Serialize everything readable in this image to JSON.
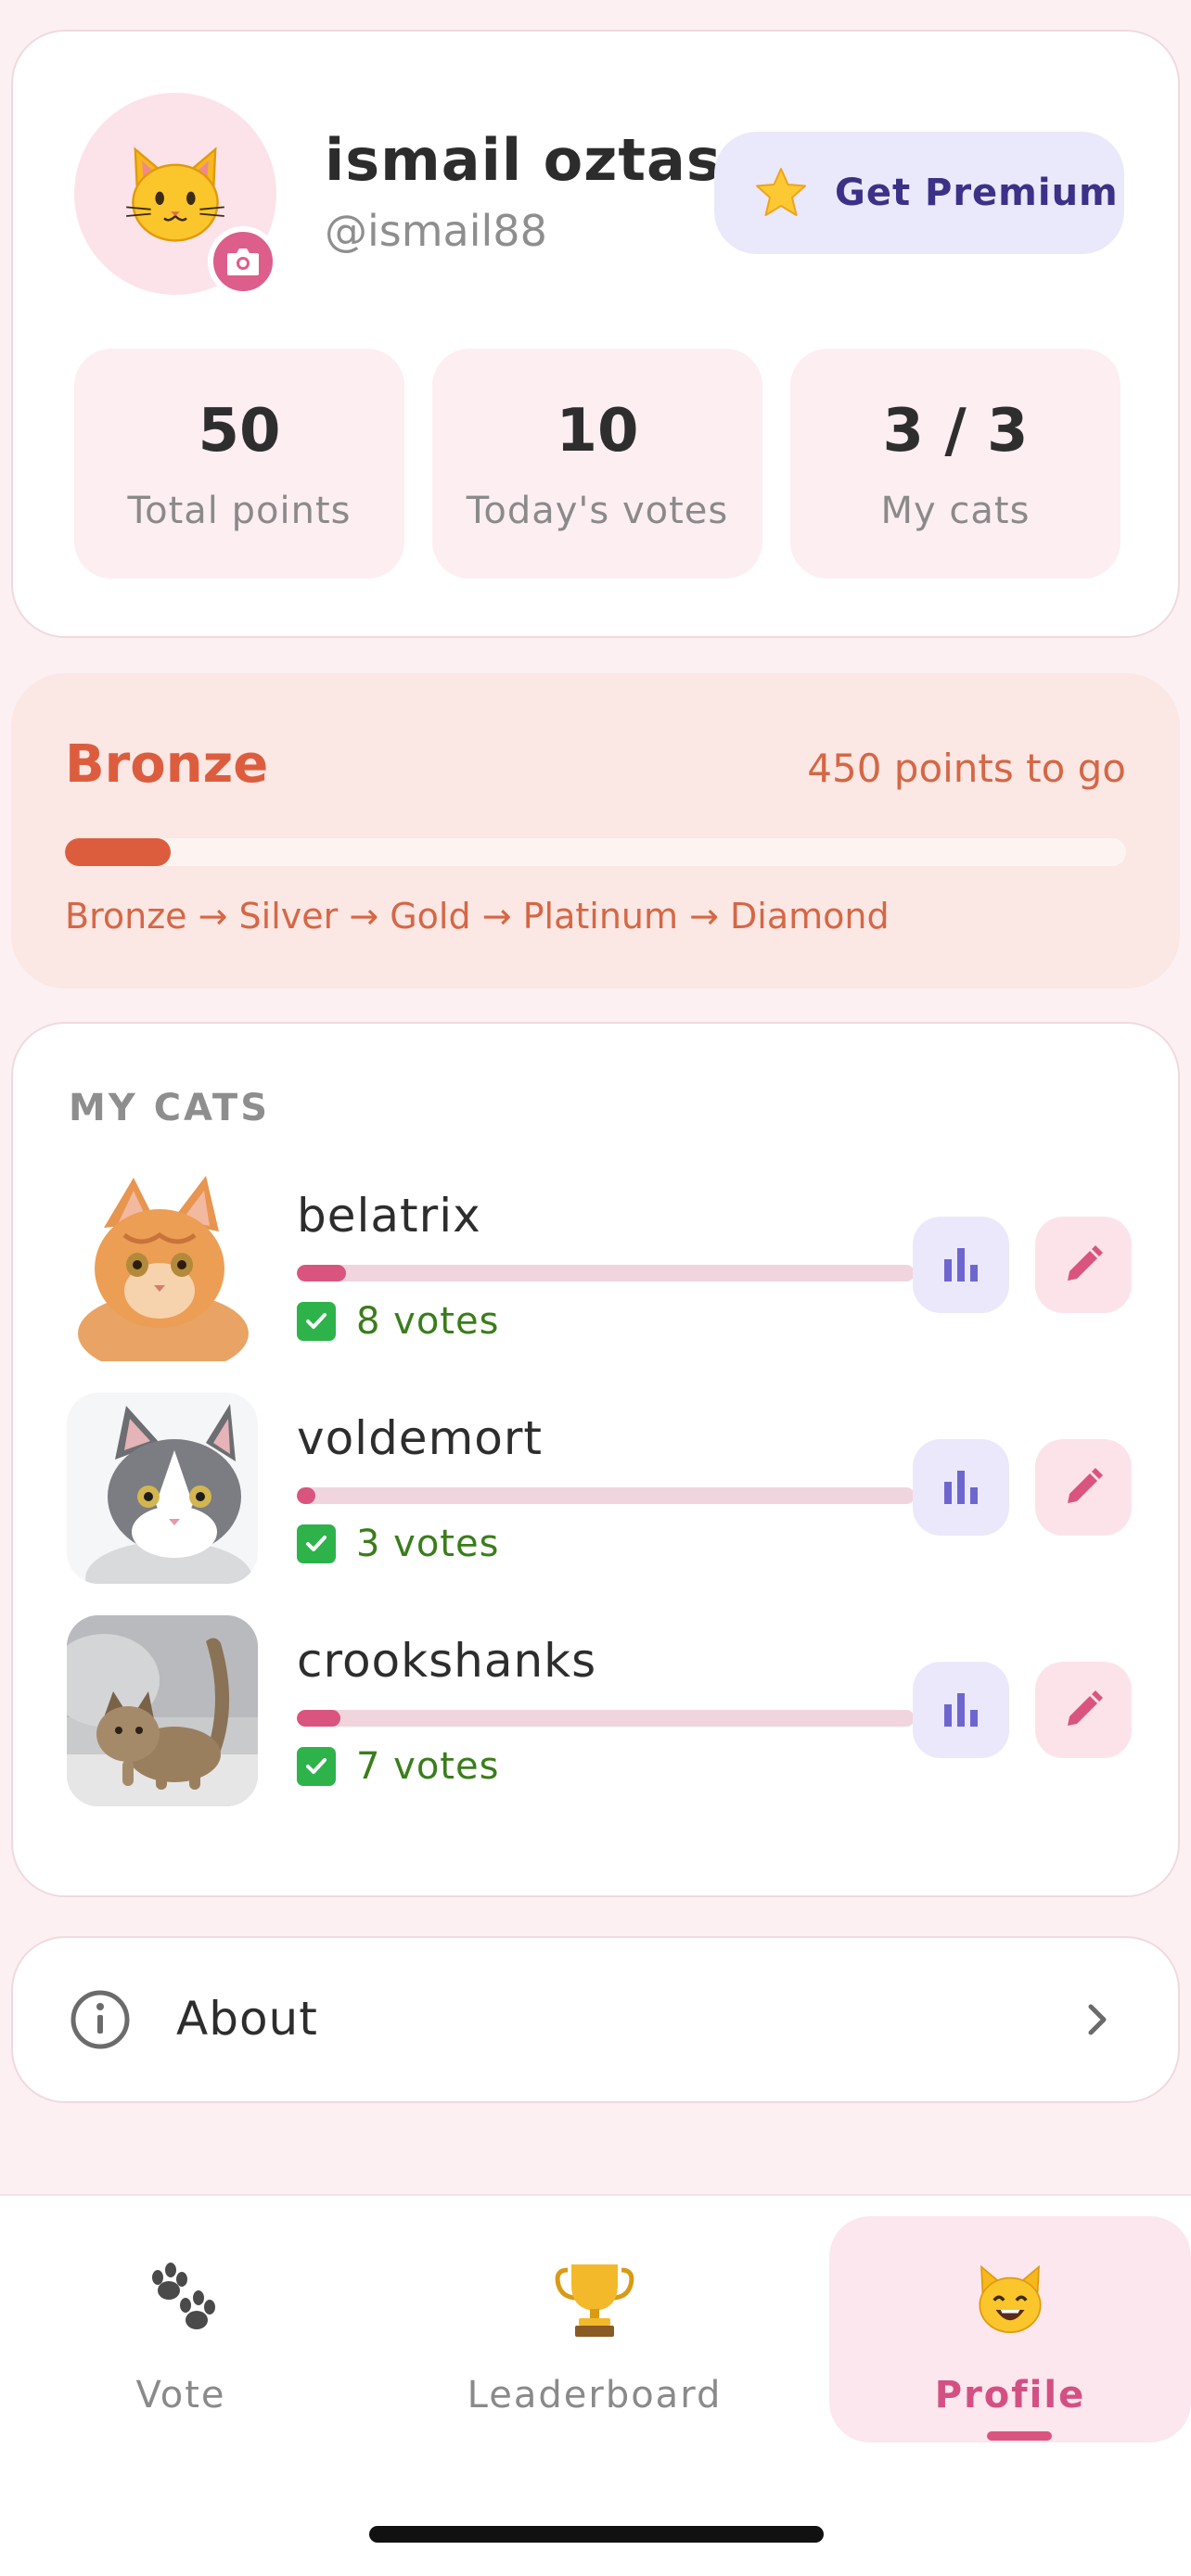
{
  "profile": {
    "name": "ismail oztas",
    "handle": "@ismail88",
    "avatar_icon": "cat-face-icon",
    "premium_button": {
      "label": "Get Premium",
      "icon": "star-icon"
    },
    "stats": [
      {
        "value": "50",
        "label": "Total points"
      },
      {
        "value": "10",
        "label": "Today's votes"
      },
      {
        "value": "3 / 3",
        "label": "My cats"
      }
    ]
  },
  "rank": {
    "name": "Bronze",
    "remaining": "450 points to go",
    "progress_percent": 10,
    "path": "Bronze → Silver → Gold → Platinum → Diamond",
    "color": "#dc5d3e"
  },
  "my_cats": {
    "title": "MY CATS",
    "cats": [
      {
        "name": "belatrix",
        "votes": "8 votes",
        "vote_progress_percent": 8
      },
      {
        "name": "voldemort",
        "votes": "3 votes",
        "vote_progress_percent": 3
      },
      {
        "name": "crookshanks",
        "votes": "7 votes",
        "vote_progress_percent": 7
      }
    ]
  },
  "about": {
    "label": "About",
    "icon": "info-icon"
  },
  "nav": {
    "items": [
      {
        "label": "Vote",
        "icon": "paw-prints-icon",
        "active": false
      },
      {
        "label": "Leaderboard",
        "icon": "trophy-icon",
        "active": false
      },
      {
        "label": "Profile",
        "icon": "smiling-cat-icon",
        "active": true
      }
    ]
  },
  "colors": {
    "background": "#fcf0f3",
    "accent_pink": "#d9557f",
    "premium": "#3b3187",
    "vote_text": "#3a7d1b"
  }
}
